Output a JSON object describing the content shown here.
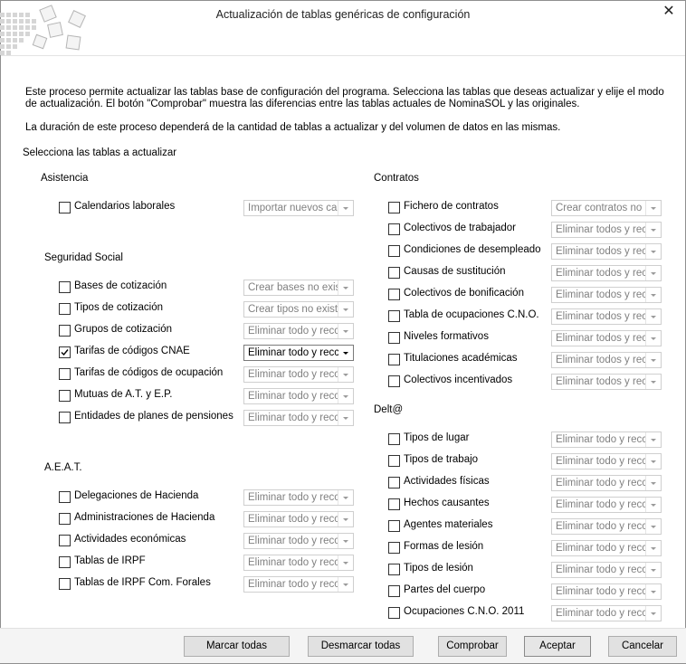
{
  "window": {
    "title": "Actualización de tablas genéricas de configuración",
    "close_glyph": "✕"
  },
  "description": {
    "line1": "Este proceso permite actualizar las tablas base de configuración del programa. Selecciona las tablas que deseas actualizar y elije el modo",
    "line2": "de actualización. El botón \"Comprobar\" muestra las diferencias entre las tablas actuales de NominaSOL y las originales.",
    "line3": "La duración de este proceso dependerá de la cantidad de tablas a actualizar y del volumen de datos en las mismas."
  },
  "select_label": "Selecciona las tablas a actualizar",
  "groups": {
    "asistencia": {
      "title": "Asistencia",
      "items": [
        {
          "label": "Calendarios laborales",
          "option": "Importar nuevos cal",
          "checked": false
        }
      ]
    },
    "seguridad_social": {
      "title": "Seguridad Social",
      "items": [
        {
          "label": "Bases de cotización",
          "option": "Crear bases no exist",
          "checked": false
        },
        {
          "label": "Tipos de cotización",
          "option": "Crear tipos no exist",
          "checked": false
        },
        {
          "label": "Grupos de cotización",
          "option": "Eliminar todo y recc",
          "checked": false
        },
        {
          "label": "Tarifas de códigos CNAE",
          "option": "Eliminar todo y recc",
          "checked": true
        },
        {
          "label": "Tarifas de códigos de ocupación",
          "option": "Eliminar todo y recc",
          "checked": false
        },
        {
          "label": "Mutuas de A.T. y E.P.",
          "option": "Eliminar todo y recc",
          "checked": false
        },
        {
          "label": "Entidades de planes de pensiones",
          "option": "Eliminar todo y recc",
          "checked": false
        }
      ]
    },
    "aeat": {
      "title": "A.E.A.T.",
      "items": [
        {
          "label": "Delegaciones de Hacienda",
          "option": "Eliminar todo y recc",
          "checked": false
        },
        {
          "label": "Administraciones de Hacienda",
          "option": "Eliminar todo y recc",
          "checked": false
        },
        {
          "label": "Actividades económicas",
          "option": "Eliminar todo y recc",
          "checked": false
        },
        {
          "label": "Tablas de IRPF",
          "option": "Eliminar todo y recc",
          "checked": false
        },
        {
          "label": "Tablas de IRPF Com. Forales",
          "option": "Eliminar todo y recc",
          "checked": false
        }
      ]
    },
    "contratos": {
      "title": "Contratos",
      "items": [
        {
          "label": "Fichero de contratos",
          "option": "Crear contratos no",
          "checked": false
        },
        {
          "label": "Colectivos de trabajador",
          "option": "Eliminar todos y rec",
          "checked": false
        },
        {
          "label": "Condiciones de desempleado",
          "option": "Eliminar todos y rec",
          "checked": false
        },
        {
          "label": "Causas de sustitución",
          "option": "Eliminar todos y rec",
          "checked": false
        },
        {
          "label": "Colectivos de bonificación",
          "option": "Eliminar todos y rec",
          "checked": false
        },
        {
          "label": "Tabla de ocupaciones C.N.O.",
          "option": "Eliminar todos y rec",
          "checked": false
        },
        {
          "label": "Niveles formativos",
          "option": "Eliminar todos y rec",
          "checked": false
        },
        {
          "label": "Titulaciones académicas",
          "option": "Eliminar todos y rec",
          "checked": false
        },
        {
          "label": "Colectivos incentivados",
          "option": "Eliminar todos y rec",
          "checked": false
        }
      ]
    },
    "delta": {
      "title": "Delt@",
      "items": [
        {
          "label": "Tipos de lugar",
          "option": "Eliminar todo y recc",
          "checked": false
        },
        {
          "label": "Tipos de trabajo",
          "option": "Eliminar todo y recc",
          "checked": false
        },
        {
          "label": "Actividades físicas",
          "option": "Eliminar todo y recc",
          "checked": false
        },
        {
          "label": "Hechos causantes",
          "option": "Eliminar todo y recc",
          "checked": false
        },
        {
          "label": "Agentes materiales",
          "option": "Eliminar todo y recc",
          "checked": false
        },
        {
          "label": "Formas de lesión",
          "option": "Eliminar todo y recc",
          "checked": false
        },
        {
          "label": "Tipos de lesión",
          "option": "Eliminar todo y recc",
          "checked": false
        },
        {
          "label": "Partes del cuerpo",
          "option": "Eliminar todo y recc",
          "checked": false
        },
        {
          "label": "Ocupaciones C.N.O. 2011",
          "option": "Eliminar todo y recc",
          "checked": false
        }
      ]
    }
  },
  "buttons": {
    "mark_all": "Marcar todas",
    "unmark_all": "Desmarcar todas",
    "check": "Comprobar",
    "accept": "Aceptar",
    "cancel": "Cancelar"
  }
}
